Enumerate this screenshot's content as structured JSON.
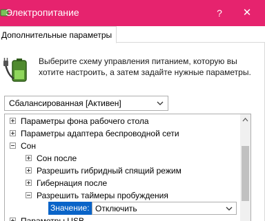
{
  "window": {
    "title": "Электропитание",
    "help_label": "?",
    "close_label": "✕"
  },
  "tab": {
    "label": "Дополнительные параметры"
  },
  "description": "Выберите схему управления питанием, которую вы хотите настроить, а затем задайте нужные параметры.",
  "scheme": {
    "selected": "Сбалансированная [Активен]"
  },
  "tree": {
    "items": [
      {
        "label": "Параметры фона рабочего стола",
        "expander": "+"
      },
      {
        "label": "Параметры адаптера беспроводной сети",
        "expander": "+"
      },
      {
        "label": "Сон",
        "expander": "-"
      },
      {
        "label": "Сон после",
        "expander": "+"
      },
      {
        "label": "Разрешить гибридный спящий режим",
        "expander": "+"
      },
      {
        "label": "Гибернация после",
        "expander": "+"
      },
      {
        "label": "Разрешить таймеры пробуждения",
        "expander": "-"
      },
      {
        "label": "Параметры USB",
        "expander": "+"
      }
    ],
    "value_label": "Значение:",
    "value_selected": "Отключить"
  },
  "colors": {
    "titlebar": "#e6236e",
    "selection": "#0a64c8"
  },
  "icons": {
    "app": "power-options-icon",
    "battery": "battery-plug-icon"
  }
}
